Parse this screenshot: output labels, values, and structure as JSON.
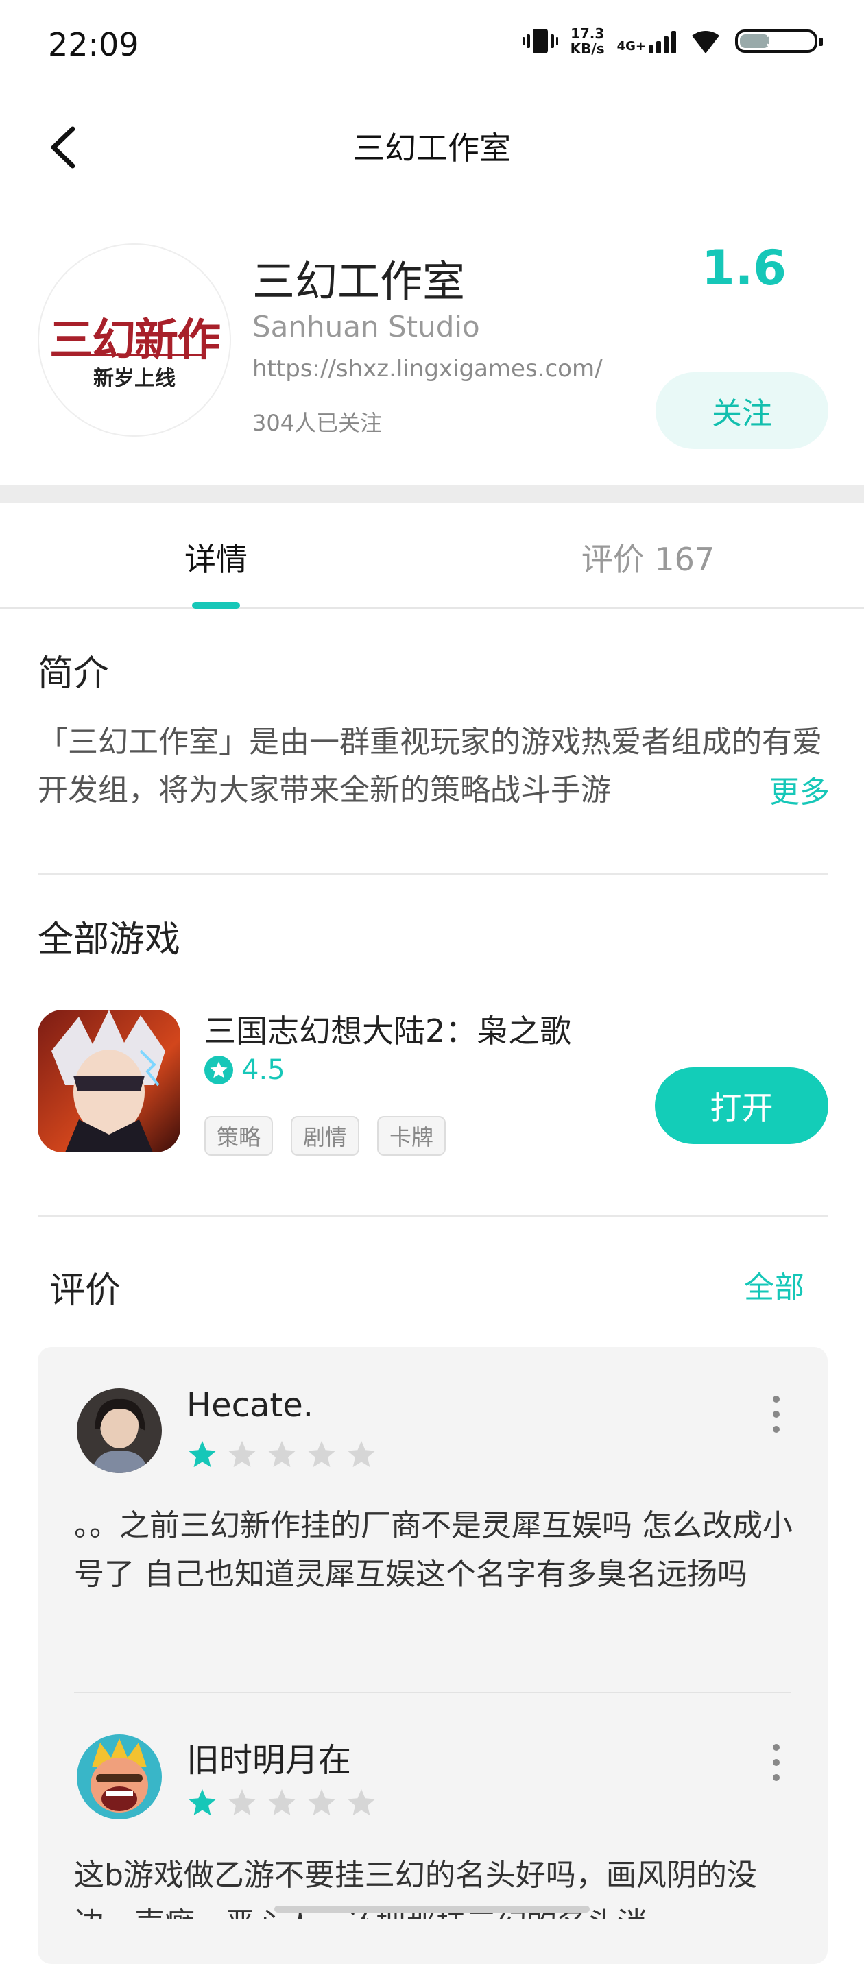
{
  "status_bar": {
    "time": "22:09",
    "speed_value": "17.3",
    "speed_unit": "KB/s",
    "network": "4G+",
    "battery": "34"
  },
  "header": {
    "title": "三幻工作室"
  },
  "studio": {
    "logo_text_main": "三幻新作",
    "logo_text_sub": "新岁上线",
    "name": "三幻工作室",
    "english_name": "Sanhuan Studio",
    "url": "https://shxz.lingxigames.com/",
    "followers": "304人已关注",
    "rating": "1.6",
    "follow_label": "关注"
  },
  "tabs": {
    "details": "详情",
    "reviews": "评价 167"
  },
  "intro": {
    "title": "简介",
    "text": "「三幻工作室」是由一群重视玩家的游戏热爱者组成的有爱开发组，将为大家带来全新的策略战斗手游",
    "more": "更多"
  },
  "games": {
    "title": "全部游戏",
    "items": [
      {
        "name": "三国志幻想大陆2：枭之歌",
        "rating": "4.5",
        "tags": [
          "策略",
          "剧情",
          "卡牌"
        ],
        "action": "打开"
      }
    ]
  },
  "reviews": {
    "title": "评价",
    "all_label": "全部",
    "items": [
      {
        "user": "Hecate.",
        "stars": 1,
        "text": "。。之前三幻新作挂的厂商不是灵犀互娱吗 怎么改成小号了 自己也知道灵犀互娱这个名字有多臭名远扬吗"
      },
      {
        "user": "旧时明月在",
        "stars": 1,
        "text": "这b游戏做乙游不要挂三幻的名头好吗，画风阴的没边，声癖，恶心人，还把那挂三幻的名头消"
      }
    ]
  },
  "colors": {
    "accent": "#16c7b8",
    "star_empty": "#d6d6d6"
  }
}
